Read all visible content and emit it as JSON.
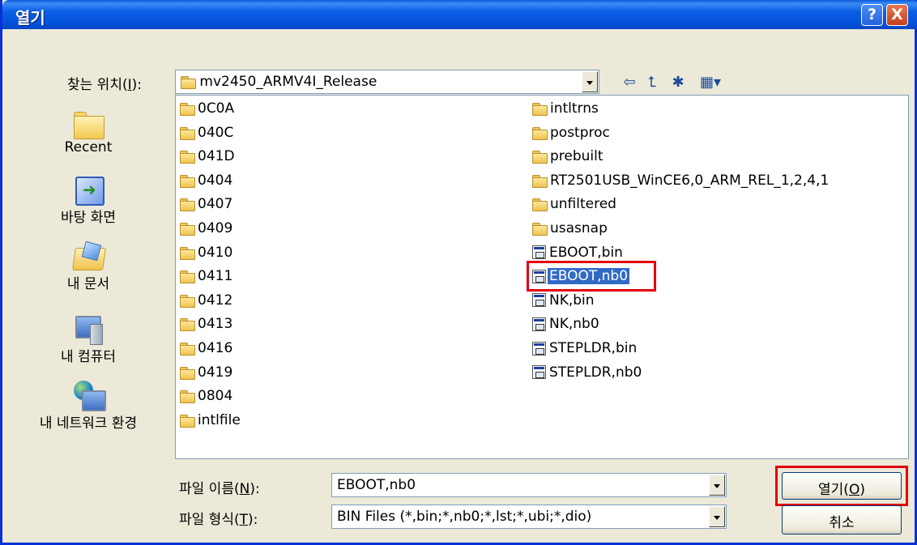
{
  "window": {
    "title": "열기",
    "help_label": "?",
    "close_label": "X"
  },
  "lookin": {
    "label_pre": "찾는 위치(",
    "label_key": "I",
    "label_post": "):",
    "value": "mv2450_ARMV4I_Release"
  },
  "toolbar": {
    "icons": [
      "back-icon",
      "up-folder-icon",
      "new-folder-icon",
      "view-menu-icon"
    ]
  },
  "places": [
    {
      "label": "Recent",
      "icon": "recent-icon"
    },
    {
      "label": "바탕 화면",
      "icon": "desktop-icon"
    },
    {
      "label": "내 문서",
      "icon": "my-documents-icon"
    },
    {
      "label": "내 컴퓨터",
      "icon": "my-computer-icon"
    },
    {
      "label": "내 네트워크 환경",
      "icon": "network-icon"
    }
  ],
  "files": {
    "col1": [
      {
        "name": "0C0A",
        "type": "folder"
      },
      {
        "name": "040C",
        "type": "folder"
      },
      {
        "name": "041D",
        "type": "folder"
      },
      {
        "name": "0404",
        "type": "folder"
      },
      {
        "name": "0407",
        "type": "folder"
      },
      {
        "name": "0409",
        "type": "folder"
      },
      {
        "name": "0410",
        "type": "folder"
      },
      {
        "name": "0411",
        "type": "folder"
      },
      {
        "name": "0412",
        "type": "folder"
      },
      {
        "name": "0413",
        "type": "folder"
      },
      {
        "name": "0416",
        "type": "folder"
      },
      {
        "name": "0419",
        "type": "folder"
      },
      {
        "name": "0804",
        "type": "folder"
      },
      {
        "name": "intlfile",
        "type": "folder"
      }
    ],
    "col2": [
      {
        "name": "intltrns",
        "type": "folder"
      },
      {
        "name": "postproc",
        "type": "folder"
      },
      {
        "name": "prebuilt",
        "type": "folder"
      },
      {
        "name": "RT2501USB_WinCE6,0_ARM_REL_1,2,4,1",
        "type": "folder"
      },
      {
        "name": "unfiltered",
        "type": "folder"
      },
      {
        "name": "usasnap",
        "type": "folder"
      },
      {
        "name": "EBOOT,bin",
        "type": "file"
      },
      {
        "name": "EBOOT,nb0",
        "type": "file",
        "selected": true
      },
      {
        "name": "NK,bin",
        "type": "file"
      },
      {
        "name": "NK,nb0",
        "type": "file"
      },
      {
        "name": "STEPLDR,bin",
        "type": "file"
      },
      {
        "name": "STEPLDR,nb0",
        "type": "file"
      }
    ]
  },
  "filename": {
    "label_pre": "파일 이름(",
    "label_key": "N",
    "label_post": "):",
    "value": "EBOOT,nb0"
  },
  "filetype": {
    "label_pre": "파일 형식(",
    "label_key": "T",
    "label_post": "):",
    "value": "BIN Files (*,bin;*,nb0;*,lst;*,ubi;*,dio)"
  },
  "buttons": {
    "open_pre": "열기(",
    "open_key": "O",
    "open_post": ")",
    "cancel": "취소"
  },
  "colors": {
    "titlebar": "#0a5fe6",
    "selection": "#316ac5",
    "highlight_box": "#e2000f"
  }
}
